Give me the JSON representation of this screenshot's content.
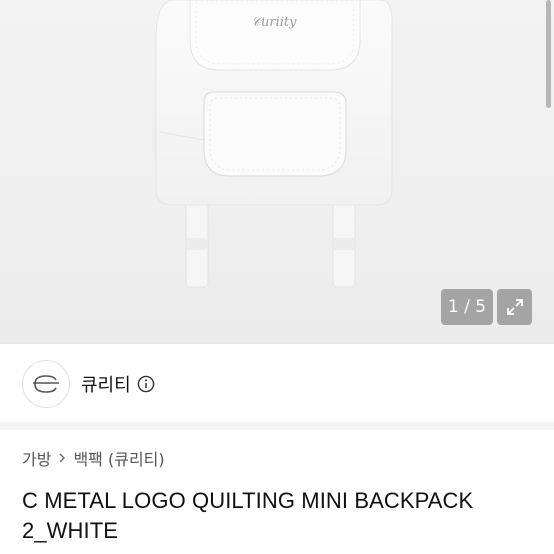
{
  "gallery": {
    "counter": "1 / 5",
    "image_alt": "white quilted mini backpack",
    "expand_icon": "expand-icon"
  },
  "shop": {
    "name": "큐리티",
    "logo_icon": "shop-logo-icon",
    "info_icon": "info-icon"
  },
  "breadcrumb": {
    "items": [
      "가방",
      "백팩 (큐리티)"
    ],
    "separator_icon": "chevron-right-icon"
  },
  "product": {
    "title": "C METAL LOGO QUILTING MINI BACKPACK 2_WHITE"
  }
}
